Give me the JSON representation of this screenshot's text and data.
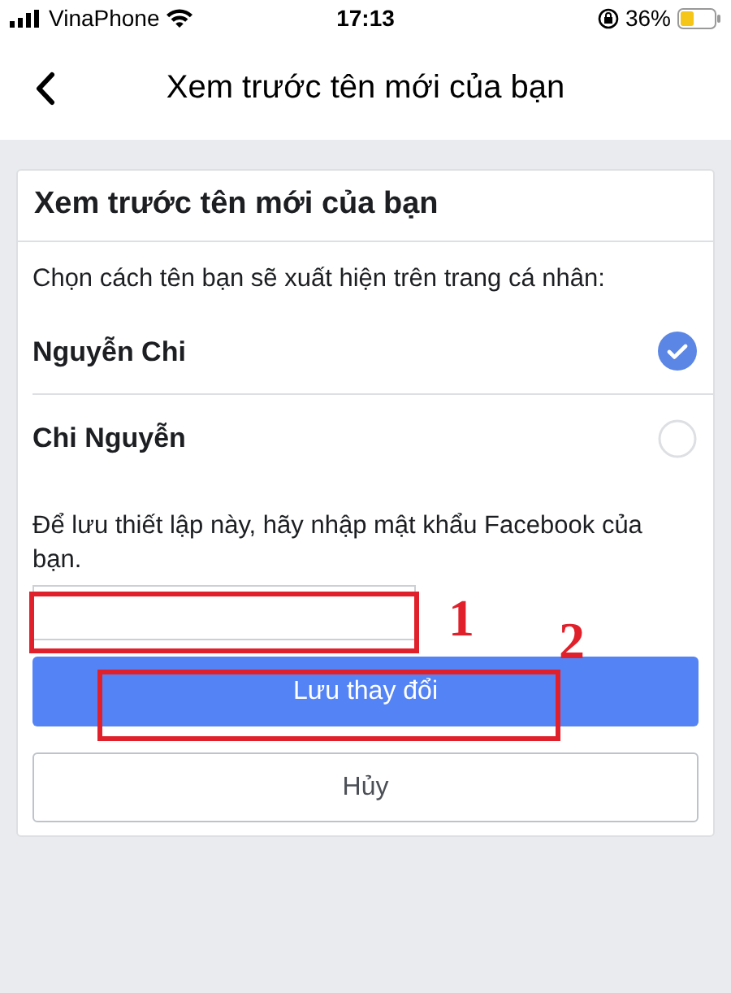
{
  "status_bar": {
    "carrier": "VinaPhone",
    "time": "17:13",
    "battery": "36%"
  },
  "header": {
    "title": "Xem trước tên mới của bạn"
  },
  "card": {
    "title": "Xem trước tên mới của bạn",
    "instruction": "Chọn cách tên bạn sẽ xuất hiện trên trang cá nhân:",
    "options": [
      {
        "label": "Nguyễn Chi",
        "selected": true
      },
      {
        "label": "Chi Nguyễn",
        "selected": false
      }
    ],
    "password_prompt": "Để lưu thiết lập này, hãy nhập mật khẩu Facebook của bạn.",
    "save_button": "Lưu thay đổi",
    "cancel_button": "Hủy"
  },
  "annotations": [
    {
      "label": "1"
    },
    {
      "label": "2"
    }
  ]
}
